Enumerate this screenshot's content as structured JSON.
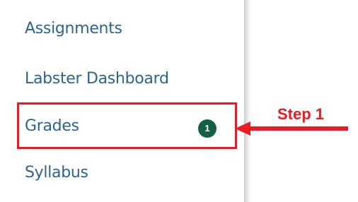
{
  "nav": {
    "items": [
      {
        "label": "Assignments"
      },
      {
        "label": "Labster Dashboard"
      },
      {
        "label": "Grades",
        "badge": "1"
      },
      {
        "label": "Syllabus"
      }
    ]
  },
  "annotation": {
    "step_label": "Step 1",
    "color": "#ec1b23"
  },
  "colors": {
    "link": "#2b6493",
    "badge": "#126048"
  }
}
